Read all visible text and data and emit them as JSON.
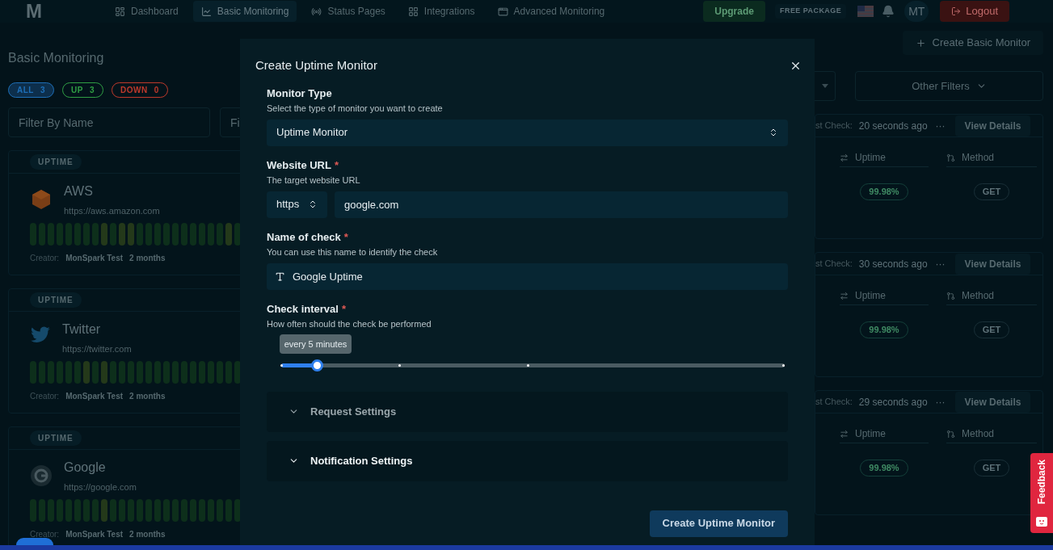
{
  "navbar": {
    "logo": "M",
    "items": [
      {
        "label": "Dashboard",
        "kind": "dashboard",
        "selected": false
      },
      {
        "label": "Basic Monitoring",
        "kind": "chart",
        "selected": true
      },
      {
        "label": "Status Pages",
        "kind": "radio",
        "selected": false
      },
      {
        "label": "Integrations",
        "kind": "grid",
        "selected": false
      },
      {
        "label": "Advanced Monitoring",
        "kind": "window",
        "selected": false
      }
    ],
    "upgrade": "Upgrade",
    "package": "FREE PACKAGE",
    "avatar": "MT",
    "logout": "Logout"
  },
  "page": {
    "title": "Basic Monitoring",
    "chips": [
      {
        "label": "ALL",
        "count": "3",
        "selected": true,
        "color": "#1d6fb8"
      },
      {
        "label": "UP",
        "count": "3",
        "selected": false,
        "color": "#2f9e44"
      },
      {
        "label": "DOWN",
        "count": "0",
        "selected": false,
        "color": "#c0392b"
      }
    ],
    "filters": [
      {
        "placeholder": "Filter By Name"
      },
      {
        "placeholder": "Fi"
      }
    ],
    "create_button": "Create Basic Monitor",
    "other_filters": "Other Filters"
  },
  "monitors": [
    {
      "type": "UPTIME",
      "kind": "cube",
      "name": "AWS",
      "url": "https://aws.amazon.com",
      "bars": [
        {
          "kind": "ok"
        },
        {
          "kind": "ok"
        },
        {
          "kind": "ok"
        },
        {
          "kind": "ok"
        },
        {
          "kind": "ok"
        },
        {
          "kind": "ok"
        },
        {
          "kind": "ok"
        },
        {
          "kind": "ok"
        },
        {
          "kind": "slow"
        },
        {
          "kind": "ok"
        },
        {
          "kind": "slow"
        },
        {
          "kind": "slow"
        },
        {
          "kind": "ok"
        },
        {
          "kind": "ok"
        },
        {
          "kind": "ok"
        },
        {
          "kind": "ok"
        },
        {
          "kind": "ok"
        },
        {
          "kind": "ok"
        },
        {
          "kind": "ok"
        },
        {
          "kind": "ok"
        },
        {
          "kind": "ok"
        },
        {
          "kind": "ok"
        },
        {
          "kind": "slow"
        },
        {
          "kind": "ok"
        }
      ],
      "creator_label": "Creator:",
      "creator": "MonSpark Test",
      "age": "2 months",
      "last_check_label": "st Check:",
      "last_check": "20 seconds ago",
      "more": "···",
      "view": "View Details",
      "uptime_header": "Uptime",
      "method_header": "Method",
      "uptime": "99.98%",
      "method": "GET"
    },
    {
      "type": "UPTIME",
      "kind": "bird",
      "name": "Twitter",
      "url": "https://twitter.com",
      "bars": [
        {
          "kind": "ok"
        },
        {
          "kind": "ok"
        },
        {
          "kind": "ok"
        },
        {
          "kind": "ok"
        },
        {
          "kind": "ok"
        },
        {
          "kind": "ok"
        },
        {
          "kind": "slow"
        },
        {
          "kind": "ok"
        },
        {
          "kind": "slow"
        },
        {
          "kind": "ok"
        },
        {
          "kind": "ok"
        },
        {
          "kind": "ok"
        },
        {
          "kind": "ok"
        },
        {
          "kind": "ok"
        },
        {
          "kind": "ok"
        },
        {
          "kind": "ok"
        },
        {
          "kind": "ok"
        },
        {
          "kind": "ok"
        },
        {
          "kind": "ok"
        },
        {
          "kind": "ok"
        },
        {
          "kind": "ok"
        },
        {
          "kind": "ok"
        },
        {
          "kind": "ok"
        },
        {
          "kind": "ok"
        }
      ],
      "creator_label": "Creator:",
      "creator": "MonSpark Test",
      "age": "2 months",
      "last_check_label": "st Check:",
      "last_check": "30 seconds ago",
      "more": "···",
      "view": "View Details",
      "uptime_header": "Uptime",
      "method_header": "Method",
      "uptime": "99.98%",
      "method": "GET"
    },
    {
      "type": "UPTIME",
      "kind": "ring",
      "name": "Google",
      "url": "https://google.com",
      "bars": [
        {
          "kind": "ok"
        },
        {
          "kind": "ok"
        },
        {
          "kind": "ok"
        },
        {
          "kind": "ok"
        },
        {
          "kind": "ok"
        },
        {
          "kind": "ok"
        },
        {
          "kind": "ok"
        },
        {
          "kind": "ok"
        },
        {
          "kind": "slow"
        },
        {
          "kind": "ok"
        },
        {
          "kind": "ok"
        },
        {
          "kind": "ok"
        },
        {
          "kind": "ok"
        },
        {
          "kind": "ok"
        },
        {
          "kind": "ok"
        },
        {
          "kind": "ok"
        },
        {
          "kind": "ok"
        },
        {
          "kind": "ok"
        },
        {
          "kind": "ok"
        },
        {
          "kind": "ok"
        },
        {
          "kind": "ok"
        },
        {
          "kind": "ok"
        },
        {
          "kind": "ok"
        },
        {
          "kind": "ok"
        }
      ],
      "creator_label": "Creator:",
      "creator": "MonSpark Test",
      "age": "2 months",
      "last_check_label": "st Check:",
      "last_check": "29 seconds ago",
      "more": "···",
      "view": "View Details",
      "uptime_header": "Uptime",
      "method_header": "Method",
      "uptime": "99.98%",
      "method": "GET"
    }
  ],
  "modal": {
    "title": "Create Uptime Monitor",
    "monitor_type": {
      "label": "Monitor Type",
      "help": "Select the type of monitor you want to create",
      "value": "Uptime Monitor"
    },
    "website_url": {
      "label": "Website URL",
      "mark": "*",
      "help": "The target website URL",
      "protocol": "https",
      "value": "google.com"
    },
    "check_name": {
      "label": "Name of check",
      "mark": "*",
      "help": "You can use this name to identify the check",
      "value": "Google Uptime"
    },
    "check_interval": {
      "label": "Check interval",
      "mark": "*",
      "help": "How often should the check be performed",
      "tooltip": "every 5 minutes",
      "level": 0.07
    },
    "sections": [
      {
        "label": "Request Settings",
        "expanded": false,
        "hovered": false
      },
      {
        "label": "Notification Settings",
        "expanded": false,
        "hovered": true
      }
    ],
    "submit": "Create Uptime Monitor"
  },
  "feedback": "Feedback"
}
